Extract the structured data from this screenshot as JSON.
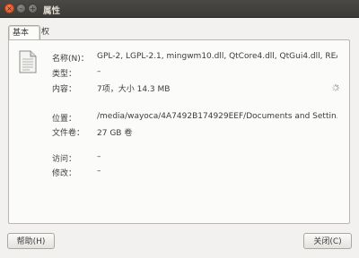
{
  "window": {
    "title": "属性",
    "close_glyph": "×",
    "min_glyph": "–",
    "max_glyph": "+"
  },
  "tabs": [
    {
      "label": "基本",
      "active": true
    },
    {
      "label": "权限",
      "active": false
    }
  ],
  "icons": {
    "file": "generic-document-icon",
    "spinner": "loading-spinner-icon"
  },
  "fields": {
    "name": {
      "label": "名称(N)：",
      "value": "GPL-2, LGPL-2.1, mingwm10.dll, QtCore4.dll, QtGui4.dll, REA..."
    },
    "type": {
      "label": "类型：",
      "value": "–"
    },
    "contents": {
      "label": "内容：",
      "value": "7项，大小 14.3 MB"
    },
    "location": {
      "label": "位置：",
      "value": "/media/wayoca/4A7492B174929EEF/Documents and Settin..."
    },
    "volume": {
      "label": "文件卷：",
      "value": "27 GB 卷"
    },
    "accessed": {
      "label": "访问：",
      "value": "–"
    },
    "modified": {
      "label": "修改：",
      "value": "–"
    }
  },
  "buttons": {
    "help": "帮助(H)",
    "close": "关闭(C)"
  },
  "colors": {
    "titlebar": "#3c3b37",
    "close_button": "#e95420",
    "window_bg": "#f2f1f0",
    "panel_bg": "#fbfbfa"
  }
}
